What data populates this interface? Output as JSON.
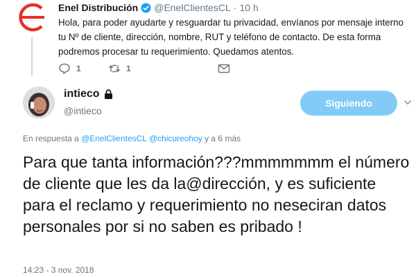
{
  "parent_tweet": {
    "author_name": "Enel Distribución",
    "handle": "@EnelClientesCL",
    "separator": "·",
    "time": "10 h",
    "text": "Hola, para poder ayudarte y resguardar tu privacidad, envíanos por mensaje interno tu Nº de cliente, dirección, nombre, RUT y teléfono de contacto. De esta forma podremos procesar tu requerimiento. Quedamos atentos.",
    "replies_count": "1",
    "retweets_count": "1",
    "colors": {
      "logo_red": "#e4312b",
      "verified_blue": "#1da1f2"
    }
  },
  "reply_tweet": {
    "author_name": "intieco",
    "handle": "@intieco",
    "follow_label": "Siguiendo",
    "context": {
      "prefix": "En respuesta a",
      "mention_1": "@EnelClientesCL",
      "mention_2": "@chicureohoy",
      "suffix": "y a 6 más"
    },
    "text": "Para que tanta información???mmmmmmm el número de cliente que les da la@dirección, y es suficiente para el reclamo y requerimiento no neseciran datos personales por si no saben es pribado !",
    "timestamp": "14:23 - 3 nov. 2018"
  },
  "icons": [
    "enel-logo-icon",
    "verified-icon",
    "reply-icon",
    "retweet-icon",
    "message-icon",
    "lock-icon",
    "chevron-down-icon"
  ]
}
